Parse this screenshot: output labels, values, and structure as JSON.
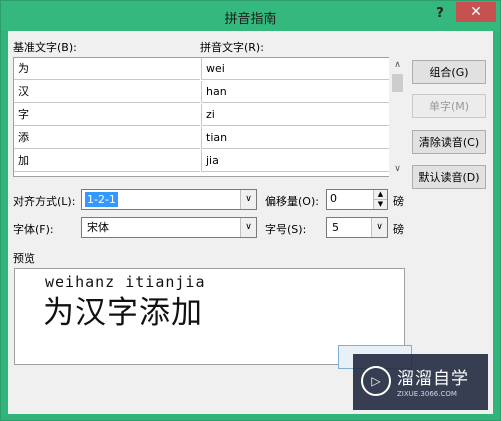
{
  "window": {
    "title": "拼音指南",
    "help_label": "?",
    "close_label": "✕"
  },
  "headers": {
    "base_text": "基准文字(B):",
    "pinyin_text": "拼音文字(R):"
  },
  "rows": [
    {
      "base": "为",
      "pinyin": "wei"
    },
    {
      "base": "汉",
      "pinyin": "han"
    },
    {
      "base": "字",
      "pinyin": "zi"
    },
    {
      "base": "添",
      "pinyin": "tian"
    },
    {
      "base": "加",
      "pinyin": "jia"
    }
  ],
  "buttons": {
    "combine": "组合(G)",
    "single": "单字(M)",
    "clear": "清除读音(C)",
    "default": "默认读音(D)"
  },
  "options": {
    "align_label": "对齐方式(L):",
    "align_value": "1-2-1",
    "offset_label": "偏移量(O):",
    "offset_value": "0",
    "offset_unit": "磅",
    "font_label": "字体(F):",
    "font_value": "宋体",
    "size_label": "字号(S):",
    "size_value": "5",
    "size_unit": "磅"
  },
  "preview": {
    "label": "预览",
    "pinyin": "weihanz itianjia",
    "hanzi": "为汉字添加"
  },
  "watermark": {
    "name": "溜溜自学",
    "url": "ZIXUE.3066.COM"
  }
}
